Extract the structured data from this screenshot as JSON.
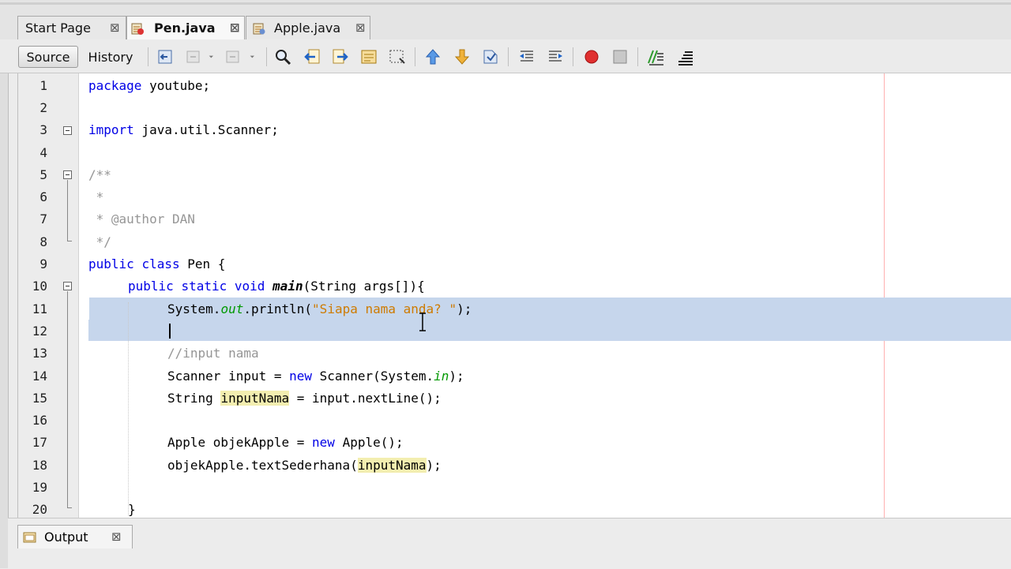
{
  "tabs": [
    {
      "label": "Start Page",
      "close": "⊠",
      "icon": "none"
    },
    {
      "label": "Pen.java",
      "close": "⊠",
      "icon": "java-file-icon",
      "active": true
    },
    {
      "label": "Apple.java",
      "close": "⊠",
      "icon": "java-file-icon"
    }
  ],
  "toolbar": {
    "source_label": "Source",
    "history_label": "History"
  },
  "editor": {
    "line_numbers": [
      "1",
      "2",
      "3",
      "4",
      "5",
      "6",
      "7",
      "8",
      "9",
      "10",
      "11",
      "12",
      "13",
      "14",
      "15",
      "16",
      "17",
      "18",
      "19",
      "20"
    ],
    "lines": {
      "l1": {
        "kw": "package",
        "rest": " youtube;"
      },
      "l3": {
        "kw": "import",
        "rest": " java.util.Scanner;"
      },
      "l5": {
        "c": "/**"
      },
      "l6": {
        "c": " *"
      },
      "l7": {
        "c": " * @author DAN"
      },
      "l8": {
        "c": " */"
      },
      "l9": {
        "kw1": "public",
        "sp1": " ",
        "kw2": "class",
        "rest": " Pen {"
      },
      "l10": {
        "kw1": "public",
        "kw2": "static",
        "kw3": "void",
        "name": "main",
        "rest": "(String args[]){"
      },
      "l11": {
        "a": "System.",
        "field": "out",
        "b": ".println(",
        "str": "\"Siapa nama anda? \"",
        "c": ");"
      },
      "l13": {
        "c": "//input nama"
      },
      "l14": {
        "a": "Scanner input = ",
        "kw": "new",
        "b": " Scanner(System.",
        "field": "in",
        "c": ");"
      },
      "l15": {
        "a": "String ",
        "var": "inputNama",
        "b": " = input.nextLine();"
      },
      "l17": {
        "a": "Apple objekApple = ",
        "kw": "new",
        "b": " Apple();"
      },
      "l18": {
        "a": "objekApple.textSederhana(",
        "var": "inputNama",
        "b": ");"
      },
      "l20": {
        "a": "}"
      }
    }
  },
  "output": {
    "label": "Output",
    "close": "⊠"
  },
  "colors": {
    "keyword": "#0000e6",
    "comment": "#969696",
    "string": "#ce7b00",
    "field": "#009900",
    "selection": "#c6d6ec",
    "mark_occurrence": "#f3eeb0"
  }
}
